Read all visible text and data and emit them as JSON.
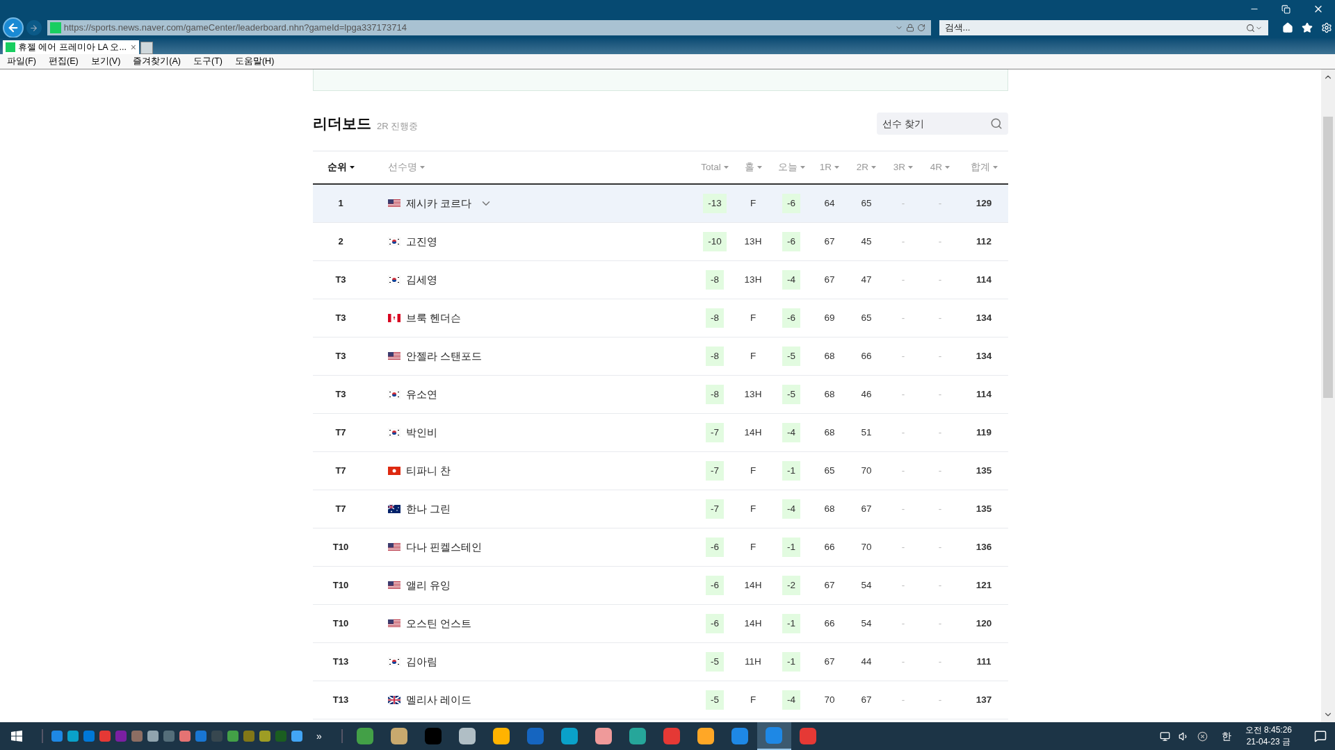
{
  "browser": {
    "url": "https://sports.news.naver.com/gameCenter/leaderboard.nhn?gameId=lpga337173714",
    "search_placeholder": "검색...",
    "tab": {
      "title": "휴젤 에어 프레미아 LA 오...",
      "close": "×"
    },
    "menu": [
      "파일(F)",
      "편집(E)",
      "보기(V)",
      "즐겨찾기(A)",
      "도구(T)",
      "도움말(H)"
    ]
  },
  "leaderboard": {
    "title": "리더보드",
    "status": "2R 진행중",
    "search_placeholder": "선수 찾기",
    "columns": [
      {
        "label": "순위",
        "selected": true
      },
      {
        "label": "선수명",
        "selected": false
      },
      {
        "label": "Total",
        "selected": false
      },
      {
        "label": "홀",
        "selected": false
      },
      {
        "label": "오늘",
        "selected": false
      },
      {
        "label": "1R",
        "selected": false
      },
      {
        "label": "2R",
        "selected": false
      },
      {
        "label": "3R",
        "selected": false
      },
      {
        "label": "4R",
        "selected": false
      },
      {
        "label": "합계",
        "selected": false
      }
    ],
    "rows": [
      {
        "rank": "1",
        "kind": "us",
        "name": "제시카 코르다",
        "expandable": true,
        "selected": true,
        "total": "-13",
        "hole": "F",
        "today": "-6",
        "r1": "64",
        "r2": "65",
        "r3": "-",
        "r4": "-",
        "sum": "129"
      },
      {
        "rank": "2",
        "kind": "kr",
        "name": "고진영",
        "expandable": false,
        "selected": false,
        "total": "-10",
        "hole": "13H",
        "today": "-6",
        "r1": "67",
        "r2": "45",
        "r3": "-",
        "r4": "-",
        "sum": "112"
      },
      {
        "rank": "T3",
        "kind": "kr",
        "name": "김세영",
        "expandable": false,
        "selected": false,
        "total": "-8",
        "hole": "13H",
        "today": "-4",
        "r1": "67",
        "r2": "47",
        "r3": "-",
        "r4": "-",
        "sum": "114"
      },
      {
        "rank": "T3",
        "kind": "ca",
        "name": "브룩 헨더슨",
        "expandable": false,
        "selected": false,
        "total": "-8",
        "hole": "F",
        "today": "-6",
        "r1": "69",
        "r2": "65",
        "r3": "-",
        "r4": "-",
        "sum": "134"
      },
      {
        "rank": "T3",
        "kind": "us",
        "name": "안젤라 스탠포드",
        "expandable": false,
        "selected": false,
        "total": "-8",
        "hole": "F",
        "today": "-5",
        "r1": "68",
        "r2": "66",
        "r3": "-",
        "r4": "-",
        "sum": "134"
      },
      {
        "rank": "T3",
        "kind": "kr",
        "name": "유소연",
        "expandable": false,
        "selected": false,
        "total": "-8",
        "hole": "13H",
        "today": "-5",
        "r1": "68",
        "r2": "46",
        "r3": "-",
        "r4": "-",
        "sum": "114"
      },
      {
        "rank": "T7",
        "kind": "kr",
        "name": "박인비",
        "expandable": false,
        "selected": false,
        "total": "-7",
        "hole": "14H",
        "today": "-4",
        "r1": "68",
        "r2": "51",
        "r3": "-",
        "r4": "-",
        "sum": "119"
      },
      {
        "rank": "T7",
        "kind": "hk",
        "name": "티파니 찬",
        "expandable": false,
        "selected": false,
        "total": "-7",
        "hole": "F",
        "today": "-1",
        "r1": "65",
        "r2": "70",
        "r3": "-",
        "r4": "-",
        "sum": "135"
      },
      {
        "rank": "T7",
        "kind": "au",
        "name": "한나 그린",
        "expandable": false,
        "selected": false,
        "total": "-7",
        "hole": "F",
        "today": "-4",
        "r1": "68",
        "r2": "67",
        "r3": "-",
        "r4": "-",
        "sum": "135"
      },
      {
        "rank": "T10",
        "kind": "us",
        "name": "다나 핀켈스테인",
        "expandable": false,
        "selected": false,
        "total": "-6",
        "hole": "F",
        "today": "-1",
        "r1": "66",
        "r2": "70",
        "r3": "-",
        "r4": "-",
        "sum": "136"
      },
      {
        "rank": "T10",
        "kind": "us",
        "name": "앨리 유잉",
        "expandable": false,
        "selected": false,
        "total": "-6",
        "hole": "14H",
        "today": "-2",
        "r1": "67",
        "r2": "54",
        "r3": "-",
        "r4": "-",
        "sum": "121"
      },
      {
        "rank": "T10",
        "kind": "us",
        "name": "오스틴 언스트",
        "expandable": false,
        "selected": false,
        "total": "-6",
        "hole": "14H",
        "today": "-1",
        "r1": "66",
        "r2": "54",
        "r3": "-",
        "r4": "-",
        "sum": "120"
      },
      {
        "rank": "T13",
        "kind": "kr",
        "name": "김아림",
        "expandable": false,
        "selected": false,
        "total": "-5",
        "hole": "11H",
        "today": "-1",
        "r1": "67",
        "r2": "44",
        "r3": "-",
        "r4": "-",
        "sum": "111"
      },
      {
        "rank": "T13",
        "kind": "gb",
        "name": "멜리사 레이드",
        "expandable": false,
        "selected": false,
        "total": "-5",
        "hole": "F",
        "today": "-4",
        "r1": "70",
        "r2": "67",
        "r3": "-",
        "r4": "-",
        "sum": "137"
      }
    ]
  },
  "taskbar": {
    "overflow": "»",
    "ime": "한",
    "time": "오전 8:45:26",
    "date": "21-04-23 금"
  }
}
